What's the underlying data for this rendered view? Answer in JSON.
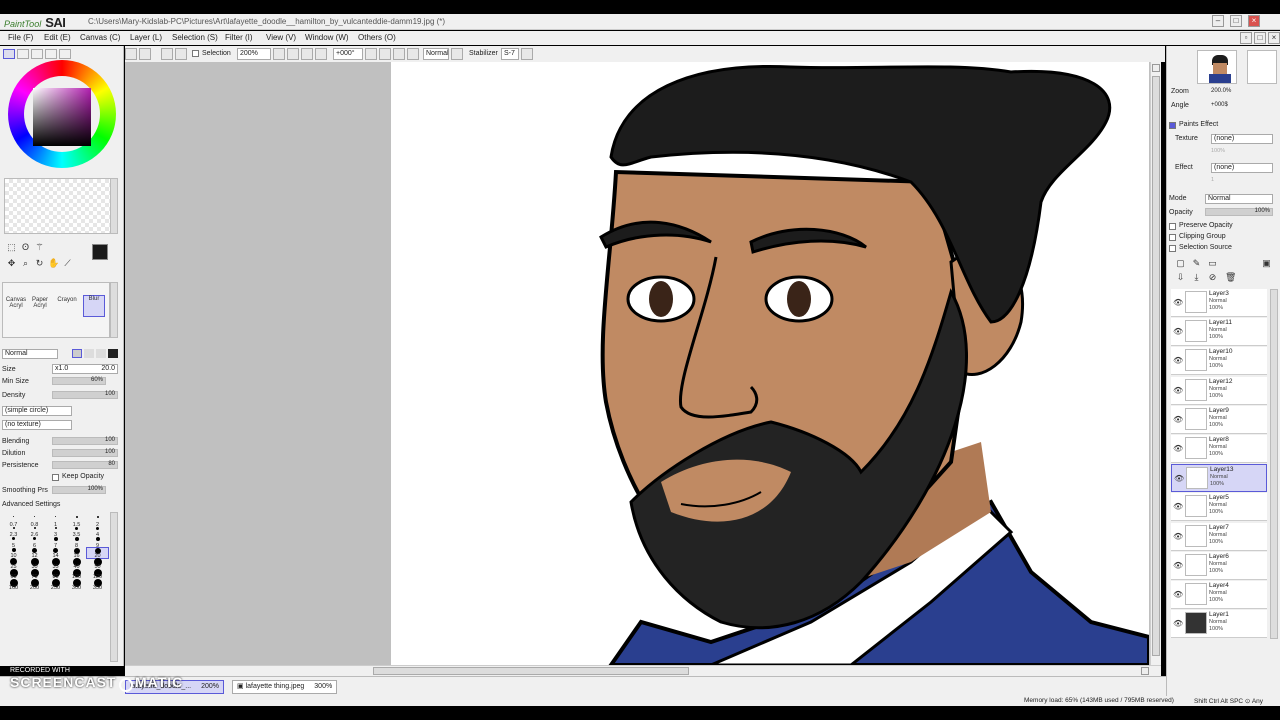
{
  "app": {
    "logo_small": "PaintTool",
    "logo_big": "SAI",
    "doc_path": "C:\\Users\\Mary-Kidslab-PC\\Pictures\\Art\\lafayette_doodle__hamilton_by_vulcanteddie-damm19.jpg (*)"
  },
  "menu": [
    "File (F)",
    "Edit (E)",
    "Canvas (C)",
    "Layer (L)",
    "Selection (S)",
    "Filter (I)",
    "View (V)",
    "Window (W)",
    "Others (O)"
  ],
  "toolbar": {
    "selection_label": "Selection",
    "zoom": "200%",
    "angle": "+000°",
    "mode": "Normal",
    "stabilizer_label": "Stabilizer",
    "stabilizer_value": "S-7"
  },
  "left": {
    "brushes": [
      "Canvas Acryl",
      "Paper Acryl",
      "Crayon",
      "Blur"
    ],
    "blend_mode": "Normal",
    "size_label": "Size",
    "size_mult": "x1.0",
    "size_value": "20.0",
    "min_size_label": "Min Size",
    "min_size_value": "60%",
    "density_label": "Density",
    "density_value": "100",
    "shape_select": "(simple circle)",
    "texture_select": "(no texture)",
    "blending_label": "Blending",
    "blending_value": "100",
    "dilution_label": "Dilution",
    "dilution_value": "100",
    "persistence_label": "Persistence",
    "persistence_value": "80",
    "keep_opacity": "Keep Opacity",
    "smoothing_label": "Smoothing Prs",
    "smoothing_value": "100%",
    "advanced": "Advanced Settings",
    "dot_sizes": [
      "0.7",
      "0.8",
      "1",
      "1.5",
      "2",
      "2.3",
      "2.6",
      "3",
      "3.5",
      "4",
      "5",
      "6",
      "7",
      "8",
      "9",
      "10",
      "12",
      "14",
      "16",
      "20",
      "25",
      "30",
      "35",
      "40",
      "50",
      "60",
      "70",
      "80",
      "100",
      "120",
      "160",
      "200",
      "250",
      "300",
      "350"
    ]
  },
  "tabs": [
    {
      "name": "lafayette_doodle_...",
      "zoom": "200%"
    },
    {
      "name": "lafayette thing.jpeg",
      "zoom": "300%"
    }
  ],
  "status": {
    "memory": "Memory load: 65% (143MB used / 795MB reserved)",
    "keys": "Shift Ctrl Alt SPC ⊙ Any"
  },
  "watermark": {
    "small": "RECORDED WITH",
    "big": "SCREENCAST",
    "end": "MATIC"
  },
  "right": {
    "zoom_label": "Zoom",
    "zoom_value": "200.0%",
    "angle_label": "Angle",
    "angle_value": "+000$",
    "paints_effect": "Paints Effect",
    "texture_label": "Texture",
    "texture_value": "(none)",
    "texture_scale": "100%",
    "effect_label": "Effect",
    "effect_value": "(none)",
    "effect_width": "1",
    "mode_label": "Mode",
    "mode_value": "Normal",
    "opacity_label": "Opacity",
    "opacity_value": "100%",
    "preserve_opacity": "Preserve Opacity",
    "clipping_group": "Clipping Group",
    "selection_source": "Selection Source",
    "layers": [
      {
        "name": "Layer3",
        "mode": "Normal",
        "opacity": "100%",
        "selected": false
      },
      {
        "name": "Layer11",
        "mode": "Normal",
        "opacity": "100%",
        "selected": false
      },
      {
        "name": "Layer10",
        "mode": "Normal",
        "opacity": "100%",
        "selected": false
      },
      {
        "name": "Layer12",
        "mode": "Normal",
        "opacity": "100%",
        "selected": false
      },
      {
        "name": "Layer9",
        "mode": "Normal",
        "opacity": "100%",
        "selected": false
      },
      {
        "name": "Layer8",
        "mode": "Normal",
        "opacity": "100%",
        "selected": false
      },
      {
        "name": "Layer13",
        "mode": "Normal",
        "opacity": "100%",
        "selected": true
      },
      {
        "name": "Layer5",
        "mode": "Normal",
        "opacity": "100%",
        "selected": false
      },
      {
        "name": "Layer7",
        "mode": "Normal",
        "opacity": "100%",
        "selected": false
      },
      {
        "name": "Layer6",
        "mode": "Normal",
        "opacity": "100%",
        "selected": false
      },
      {
        "name": "Layer4",
        "mode": "Normal",
        "opacity": "100%",
        "selected": false
      },
      {
        "name": "Layer1",
        "mode": "Normal",
        "opacity": "100%",
        "selected": false
      }
    ]
  },
  "colors": {
    "accent": "#5a5ad8",
    "current_color": "#1a1a1a",
    "coat": "#2a3f8f",
    "skin": "#c08a63",
    "hair": "#1c1c1c"
  }
}
